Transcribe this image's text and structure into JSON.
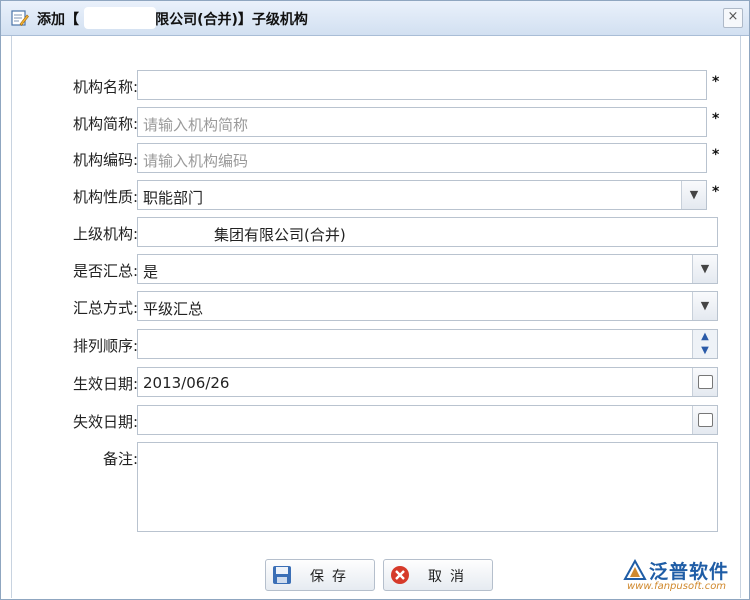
{
  "window": {
    "title": "添加【       集团有限公司(合并)】子级机构",
    "close_glyph": "×"
  },
  "form": {
    "fields": [
      {
        "label": "机构名称:",
        "value": "",
        "placeholder": "",
        "required": "*"
      },
      {
        "label": "机构简称:",
        "value": "",
        "placeholder": "请输入机构简称",
        "required": "*"
      },
      {
        "label": "机构编码:",
        "value": "",
        "placeholder": "请输入机构编码",
        "required": "*"
      },
      {
        "label": "机构性质:",
        "value": "职能部门",
        "required": "*"
      },
      {
        "label": "上级机构:",
        "value": "集团有限公司(合并)"
      },
      {
        "label": "是否汇总:",
        "value": "是"
      },
      {
        "label": "汇总方式:",
        "value": "平级汇总"
      },
      {
        "label": "排列顺序:",
        "value": ""
      },
      {
        "label": "生效日期:",
        "value": "2013/06/26"
      },
      {
        "label": "失效日期:",
        "value": ""
      },
      {
        "label": "备注:",
        "value": ""
      }
    ]
  },
  "buttons": {
    "save": "保存",
    "cancel": "取消"
  },
  "logo": {
    "name": "泛普软件",
    "url": "www.fanpusoft.com"
  },
  "icons": {
    "title": "edit-form-icon",
    "dropdown": "chevron-down-icon",
    "spinner": "spinner-icon",
    "calendar": "calendar-icon",
    "save": "floppy-disk-icon",
    "cancel": "cancel-x-icon"
  }
}
